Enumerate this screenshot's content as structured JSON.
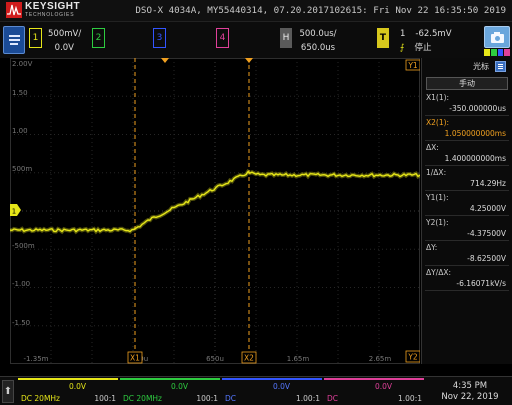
{
  "header": {
    "brand": "KEYSIGHT",
    "brand_sub": "TECHNOLOGIES",
    "scope_info": "DSO-X 4034A, MY55440314, 07.20.2017102615: Fri Nov 22 16:35:50 2019"
  },
  "topbar": {
    "ch1": {
      "num": "1",
      "scale": "500mV/",
      "offset": "0.0V"
    },
    "ch2": {
      "num": "2"
    },
    "ch3": {
      "num": "3"
    },
    "ch4": {
      "num": "4"
    },
    "horizontal": {
      "label": "H",
      "scale": "500.0us/",
      "delay": "650.0us"
    },
    "trigger": {
      "label": "T",
      "source": "1",
      "level": "-62.5mV",
      "state": "停止"
    }
  },
  "graticule": {
    "y_labels": [
      "2.00V",
      "1.50",
      "1.00",
      "500m",
      "-500m",
      "-1.00",
      "-1.50"
    ],
    "x_labels": [
      "-1.35m",
      "-350u",
      "650u",
      "1.65m",
      "2.65m"
    ],
    "markers": {
      "x1": "X1",
      "x2": "X2",
      "y1": "Y1",
      "y2": "Y2",
      "ch1": "1"
    }
  },
  "panel": {
    "title": "光标",
    "mode": "手动",
    "items": [
      {
        "label": "X1(1):",
        "value": "-350.000000us",
        "highlight": false
      },
      {
        "label": "X2(1):",
        "value": "1.050000000ms",
        "highlight": true
      },
      {
        "label": "ΔX:",
        "value": "1.400000000ms",
        "highlight": false
      },
      {
        "label": "1/ΔX:",
        "value": "714.29Hz",
        "highlight": false
      },
      {
        "label": "Y1(1):",
        "value": "4.25000V",
        "highlight": false
      },
      {
        "label": "Y2(1):",
        "value": "-4.37500V",
        "highlight": false
      },
      {
        "label": "ΔY:",
        "value": "-8.62500V",
        "highlight": false
      },
      {
        "label": "ΔY/ΔX:",
        "value": "-6.16071kV/s",
        "highlight": false
      }
    ]
  },
  "bottom": {
    "channels": [
      {
        "volt": "0.0V",
        "coupling": "DC 20MHz",
        "probe": "100:1"
      },
      {
        "volt": "0.0V",
        "coupling": "DC 20MHz",
        "probe": "100:1"
      },
      {
        "volt": "0.0V",
        "coupling": "DC",
        "probe": "1.00:1"
      },
      {
        "volt": "0.0V",
        "coupling": "DC",
        "probe": "1.00:1"
      }
    ],
    "time": "4:35 PM",
    "date": "Nov 22, 2019"
  },
  "colors": {
    "ch1": "#e6e619",
    "ch2": "#2ecc40",
    "ch3": "#3355ff",
    "ch4": "#e0409a",
    "cursor": "#f0a020"
  }
}
